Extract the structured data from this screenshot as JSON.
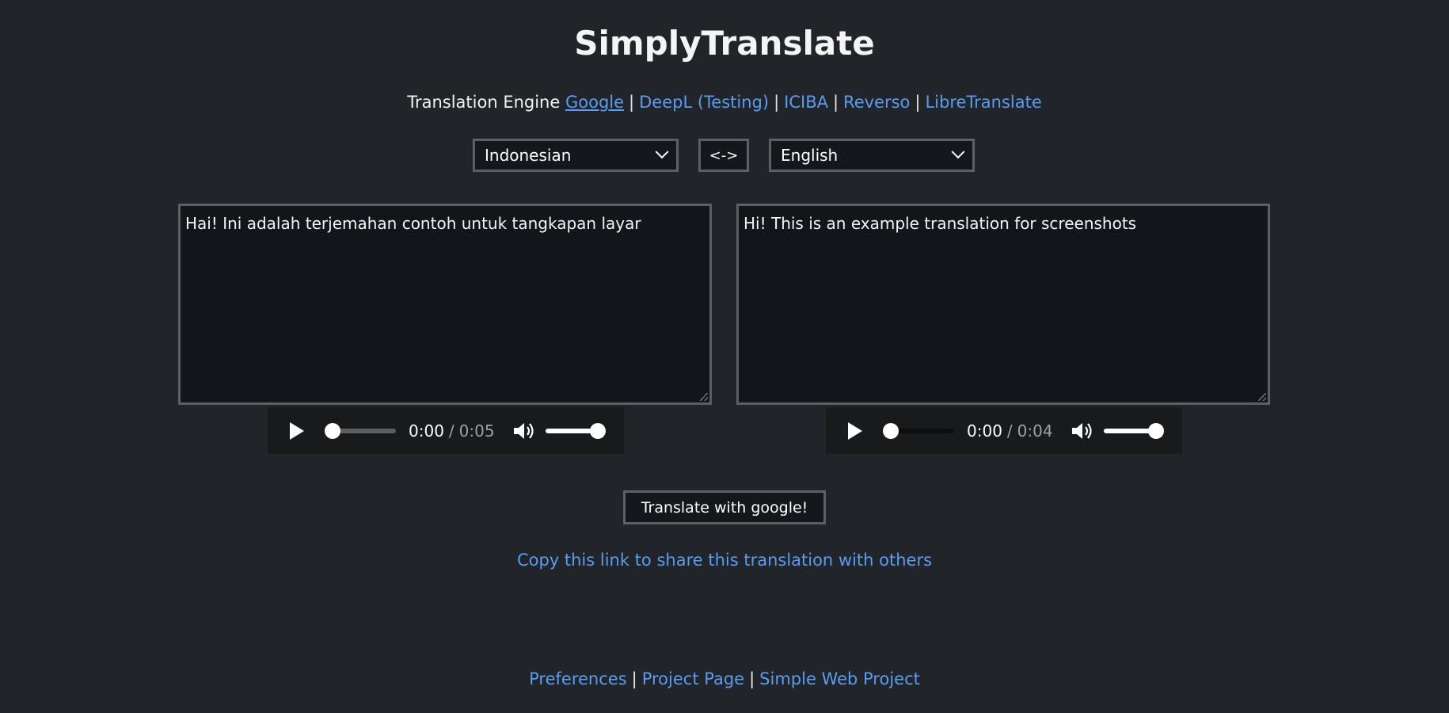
{
  "header": {
    "title": "SimplyTranslate"
  },
  "engines": {
    "label": "Translation Engine",
    "items": [
      {
        "label": "Google",
        "active": true
      },
      {
        "label": "DeepL (Testing)",
        "active": false
      },
      {
        "label": "ICIBA",
        "active": false
      },
      {
        "label": "Reverso",
        "active": false
      },
      {
        "label": "LibreTranslate",
        "active": false
      }
    ],
    "separator": "|"
  },
  "languages": {
    "source": "Indonesian",
    "target": "English",
    "swap_label": "<->"
  },
  "input": {
    "text": "Hai! Ini adalah terjemahan contoh untuk tangkapan layar"
  },
  "output": {
    "text": "Hi! This is an example translation for screenshots"
  },
  "source_audio": {
    "current": "0:00",
    "separator": "/",
    "duration": "0:05",
    "progress": 0,
    "volume": 1.0
  },
  "target_audio": {
    "current": "0:00",
    "separator": "/",
    "duration": "0:04",
    "progress": 0,
    "volume": 1.0
  },
  "actions": {
    "translate_label": "Translate with google!",
    "share_label": "Copy this link to share this translation with others"
  },
  "footer": {
    "links": [
      "Preferences",
      "Project Page",
      "Simple Web Project"
    ],
    "separator": "|"
  },
  "colors": {
    "background": "#212429",
    "link": "#5a9cf0",
    "border": "#5c5f66",
    "field": "#121519"
  }
}
